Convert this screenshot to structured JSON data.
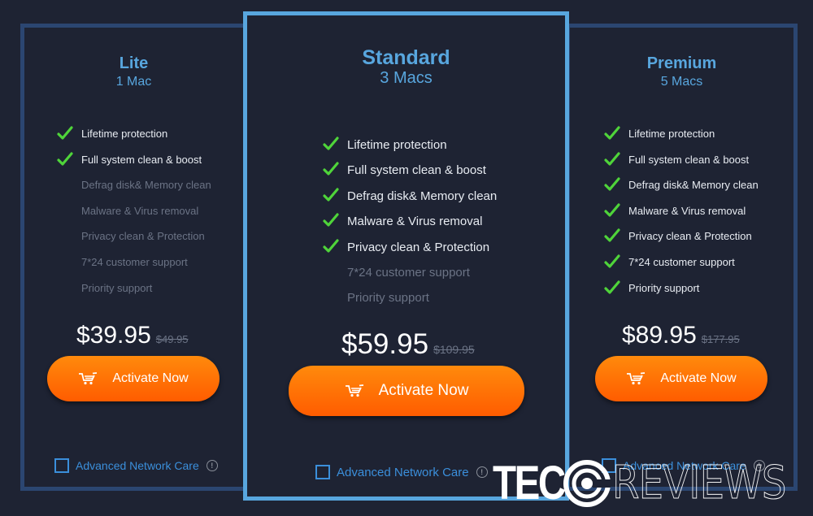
{
  "plans": [
    {
      "name": "Lite",
      "devices": "1 Mac",
      "features": [
        {
          "label": "Lifetime protection",
          "included": true
        },
        {
          "label": "Full system clean & boost",
          "included": true
        },
        {
          "label": "Defrag disk& Memory clean",
          "included": false
        },
        {
          "label": "Malware & Virus removal",
          "included": false
        },
        {
          "label": "Privacy clean & Protection",
          "included": false
        },
        {
          "label": "7*24 customer support",
          "included": false
        },
        {
          "label": "Priority support",
          "included": false
        }
      ],
      "price": "$39.95",
      "old_price": "$49.95",
      "button_label": "Activate Now",
      "addon_label": "Advanced Network Care",
      "addon_checked": false
    },
    {
      "name": "Standard",
      "devices": "3 Macs",
      "featured": true,
      "features": [
        {
          "label": "Lifetime protection",
          "included": true
        },
        {
          "label": "Full system clean & boost",
          "included": true
        },
        {
          "label": "Defrag disk& Memory clean",
          "included": true
        },
        {
          "label": "Malware & Virus removal",
          "included": true
        },
        {
          "label": "Privacy clean & Protection",
          "included": true
        },
        {
          "label": "7*24 customer support",
          "included": false
        },
        {
          "label": "Priority support",
          "included": false
        }
      ],
      "price": "$59.95",
      "old_price": "$109.95",
      "button_label": "Activate Now",
      "addon_label": "Advanced Network Care",
      "addon_checked": false
    },
    {
      "name": "Premium",
      "devices": "5 Macs",
      "features": [
        {
          "label": "Lifetime protection",
          "included": true
        },
        {
          "label": "Full system clean & boost",
          "included": true
        },
        {
          "label": "Defrag disk& Memory clean",
          "included": true
        },
        {
          "label": "Malware & Virus removal",
          "included": true
        },
        {
          "label": "Privacy clean & Protection",
          "included": true
        },
        {
          "label": "7*24 customer support",
          "included": true
        },
        {
          "label": "Priority support",
          "included": true
        }
      ],
      "price": "$89.95",
      "old_price": "$177.95",
      "button_label": "Activate Now",
      "addon_label": "Advanced Network Care",
      "addon_checked": false
    }
  ],
  "icons": {
    "check": "check-icon",
    "cart": "shopping-cart-icon",
    "info": "info-icon"
  },
  "info_glyph": "!",
  "watermark": {
    "bold": "TEC",
    "thin": "REVIEWS"
  },
  "colors": {
    "background": "#1e2333",
    "card_border": "#2b4671",
    "featured_border": "#58a6de",
    "accent_blue": "#58a6de",
    "link_blue": "#3b8fdb",
    "check_green": "#4fd43a",
    "button_orange_top": "#ff8a0c",
    "button_orange_bottom": "#ff5c00",
    "muted_text": "#6b7385"
  }
}
